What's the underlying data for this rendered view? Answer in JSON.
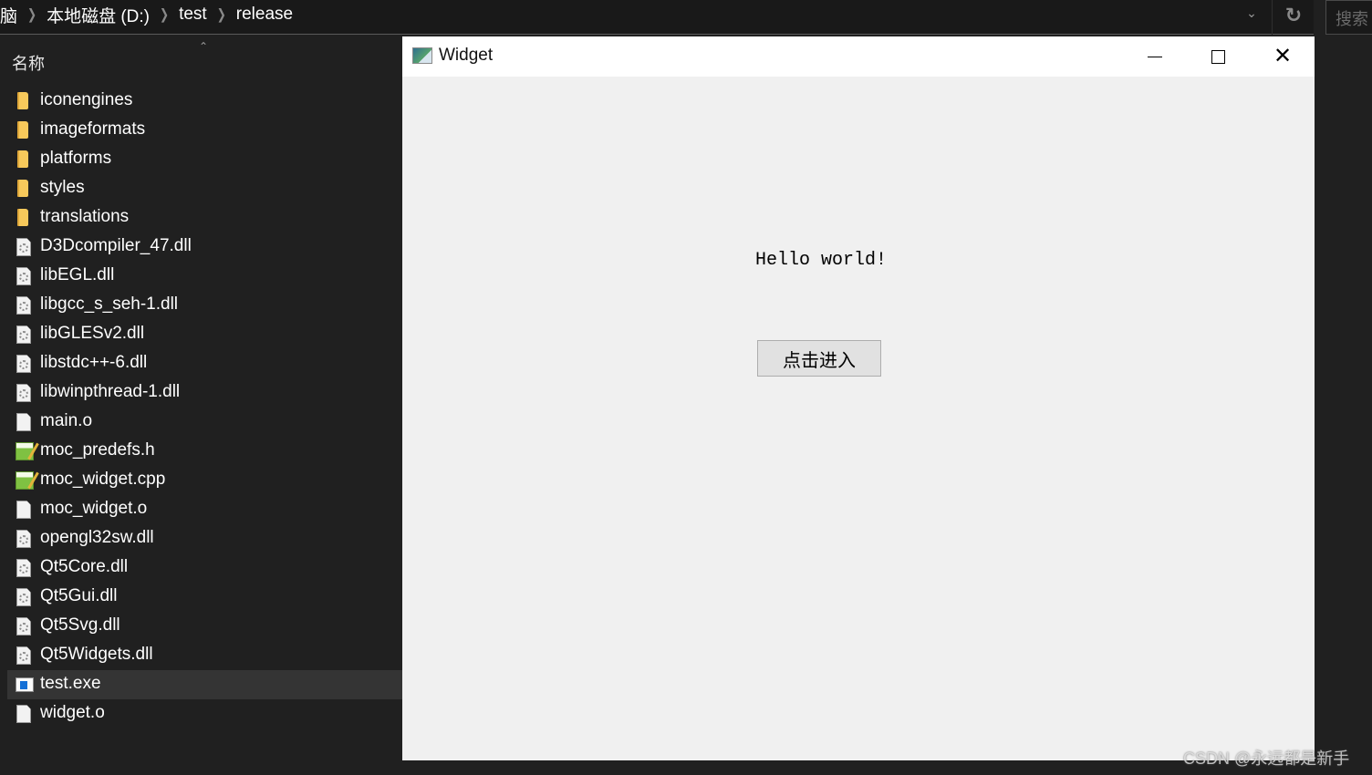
{
  "explorer": {
    "breadcrumb": [
      "脑",
      "本地磁盘 (D:)",
      "test",
      "release"
    ],
    "search_placeholder": "搜索",
    "column_header": "名称",
    "files": [
      {
        "name": "iconengines",
        "type": "folder",
        "icon": "folder-icon"
      },
      {
        "name": "imageformats",
        "type": "folder",
        "icon": "folder-icon"
      },
      {
        "name": "platforms",
        "type": "folder",
        "icon": "folder-icon"
      },
      {
        "name": "styles",
        "type": "folder",
        "icon": "folder-icon"
      },
      {
        "name": "translations",
        "type": "folder",
        "icon": "folder-icon"
      },
      {
        "name": "D3Dcompiler_47.dll",
        "type": "dll",
        "icon": "dll-file-icon"
      },
      {
        "name": "libEGL.dll",
        "type": "dll",
        "icon": "dll-file-icon"
      },
      {
        "name": "libgcc_s_seh-1.dll",
        "type": "dll",
        "icon": "dll-file-icon"
      },
      {
        "name": "libGLESv2.dll",
        "type": "dll",
        "icon": "dll-file-icon"
      },
      {
        "name": "libstdc++-6.dll",
        "type": "dll",
        "icon": "dll-file-icon"
      },
      {
        "name": "libwinpthread-1.dll",
        "type": "dll",
        "icon": "dll-file-icon"
      },
      {
        "name": "main.o",
        "type": "file",
        "icon": "blank-file-icon"
      },
      {
        "name": "moc_predefs.h",
        "type": "source",
        "icon": "source-file-icon"
      },
      {
        "name": "moc_widget.cpp",
        "type": "source",
        "icon": "source-file-icon"
      },
      {
        "name": "moc_widget.o",
        "type": "file",
        "icon": "blank-file-icon"
      },
      {
        "name": "opengl32sw.dll",
        "type": "dll",
        "icon": "dll-file-icon"
      },
      {
        "name": "Qt5Core.dll",
        "type": "dll",
        "icon": "dll-file-icon"
      },
      {
        "name": "Qt5Gui.dll",
        "type": "dll",
        "icon": "dll-file-icon"
      },
      {
        "name": "Qt5Svg.dll",
        "type": "dll",
        "icon": "dll-file-icon"
      },
      {
        "name": "Qt5Widgets.dll",
        "type": "dll",
        "icon": "dll-file-icon"
      },
      {
        "name": "test.exe",
        "type": "exe",
        "icon": "exe-file-icon",
        "selected": true
      },
      {
        "name": "widget.o",
        "type": "file",
        "icon": "blank-file-icon"
      }
    ]
  },
  "widget_window": {
    "title": "Widget",
    "label_text": "Hello world!",
    "button_label": "点击进入"
  },
  "watermark": "CSDN @永远都是新手"
}
